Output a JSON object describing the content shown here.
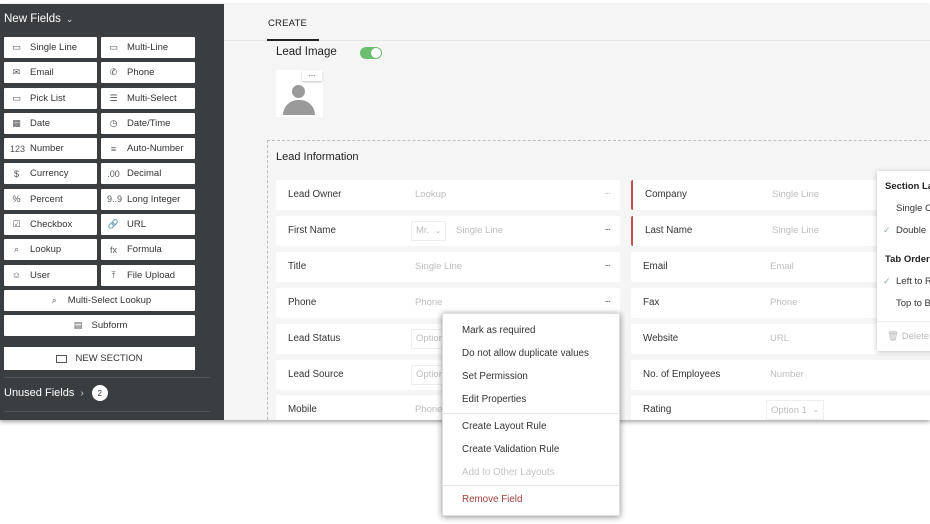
{
  "sidebar": {
    "title": "New Fields",
    "fields": [
      {
        "label": "Single Line",
        "icon": "single-line-icon",
        "glyph": "▭"
      },
      {
        "label": "Multi-Line",
        "icon": "multi-line-icon",
        "glyph": "▭"
      },
      {
        "label": "Email",
        "icon": "email-icon",
        "glyph": "✉"
      },
      {
        "label": "Phone",
        "icon": "phone-icon",
        "glyph": "✆"
      },
      {
        "label": "Pick List",
        "icon": "pick-list-icon",
        "glyph": "▭"
      },
      {
        "label": "Multi-Select",
        "icon": "multi-select-icon",
        "glyph": "☰"
      },
      {
        "label": "Date",
        "icon": "date-icon",
        "glyph": "▦"
      },
      {
        "label": "Date/Time",
        "icon": "date-time-icon",
        "glyph": "◷"
      },
      {
        "label": "Number",
        "icon": "number-icon",
        "glyph": "123"
      },
      {
        "label": "Auto-Number",
        "icon": "auto-number-icon",
        "glyph": "≡"
      },
      {
        "label": "Currency",
        "icon": "currency-icon",
        "glyph": "$"
      },
      {
        "label": "Decimal",
        "icon": "decimal-icon",
        "glyph": ".00"
      },
      {
        "label": "Percent",
        "icon": "percent-icon",
        "glyph": "%"
      },
      {
        "label": "Long Integer",
        "icon": "long-integer-icon",
        "glyph": "9..9"
      },
      {
        "label": "Checkbox",
        "icon": "checkbox-icon",
        "glyph": "☑"
      },
      {
        "label": "URL",
        "icon": "link-icon",
        "glyph": "🔗"
      },
      {
        "label": "Lookup",
        "icon": "lookup-icon",
        "glyph": "⌕"
      },
      {
        "label": "Formula",
        "icon": "formula-icon",
        "glyph": "fx"
      },
      {
        "label": "User",
        "icon": "user-icon",
        "glyph": "☺"
      },
      {
        "label": "File Upload",
        "icon": "file-upload-icon",
        "glyph": "⤒"
      }
    ],
    "wide_fields": [
      {
        "label": "Multi-Select Lookup",
        "icon": "multi-select-lookup-icon",
        "glyph": "⌕"
      },
      {
        "label": "Subform",
        "icon": "subform-icon",
        "glyph": "▤"
      }
    ],
    "new_section": "NEW SECTION",
    "unused_fields": {
      "label": "Unused Fields",
      "count": "2"
    }
  },
  "tabs": [
    {
      "label": "CREATE",
      "active": true
    }
  ],
  "lead_image": {
    "label": "Lead Image",
    "enabled": true,
    "menu": "..."
  },
  "section": {
    "title": "Lead Information",
    "left_fields": [
      {
        "label": "Lead Owner",
        "type": "Lookup"
      },
      {
        "label": "First Name",
        "type": "Single Line",
        "salutation": "Mr."
      },
      {
        "label": "Title",
        "type": "Single Line"
      },
      {
        "label": "Phone",
        "type": "Phone"
      },
      {
        "label": "Lead Status",
        "type": "Option"
      },
      {
        "label": "Lead Source",
        "type": "Option"
      },
      {
        "label": "Mobile",
        "type": "Phone"
      }
    ],
    "right_fields": [
      {
        "label": "Company",
        "type": "Single Line",
        "required": true
      },
      {
        "label": "Last Name",
        "type": "Single Line",
        "required": true
      },
      {
        "label": "Email",
        "type": "Email"
      },
      {
        "label": "Fax",
        "type": "Phone"
      },
      {
        "label": "Website",
        "type": "URL"
      },
      {
        "label": "No. of Employees",
        "type": "Number"
      },
      {
        "label": "Rating",
        "type": "Option 1"
      }
    ],
    "more": "..."
  },
  "context_menu": {
    "items": [
      {
        "label": "Mark as required"
      },
      {
        "label": "Do not allow duplicate values"
      },
      {
        "label": "Set Permission"
      },
      {
        "label": "Edit Properties"
      },
      {
        "label": "Create Layout Rule"
      },
      {
        "label": "Create Validation Rule"
      },
      {
        "label": "Add to Other Layouts",
        "disabled": true
      },
      {
        "label": "Remove Field",
        "danger": true
      }
    ]
  },
  "section_panel": {
    "layout_heading": "Section La",
    "layout_options": [
      {
        "label": "Single C",
        "checked": false
      },
      {
        "label": "Double",
        "checked": true
      }
    ],
    "tab_heading": "Tab Order",
    "tab_options": [
      {
        "label": "Left to R",
        "checked": true
      },
      {
        "label": "Top to B",
        "checked": false
      }
    ],
    "delete": "Delete",
    "check_glyph": "✓"
  }
}
